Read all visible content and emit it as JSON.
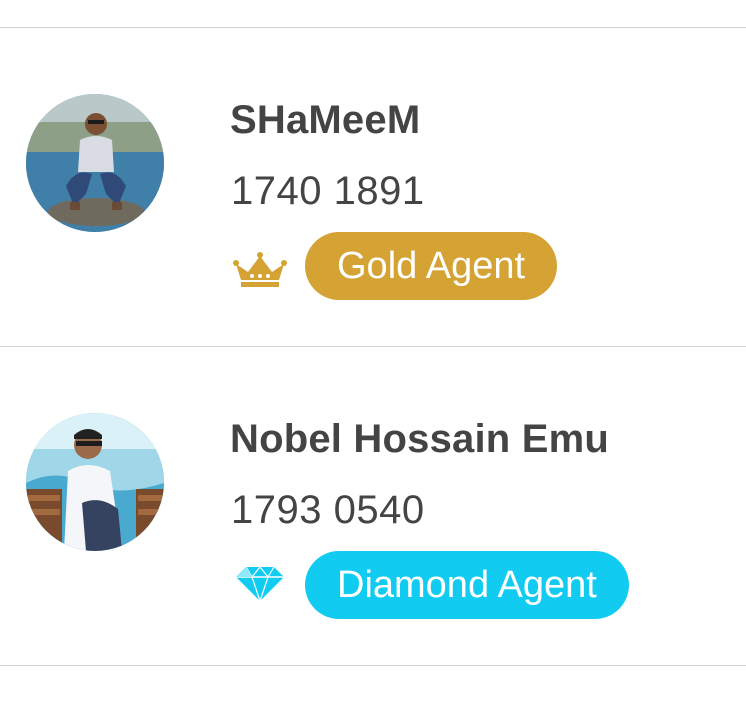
{
  "agents": [
    {
      "name": "SHaMeeM",
      "phone": "1740 1891",
      "tier": "Gold Agent",
      "tier_icon": "crown-icon",
      "tier_color": "#d4a334"
    },
    {
      "name": "Nobel Hossain Emu",
      "phone": "1793 0540",
      "tier": "Diamond Agent",
      "tier_icon": "diamond-icon",
      "tier_color": "#12cbf0"
    }
  ]
}
